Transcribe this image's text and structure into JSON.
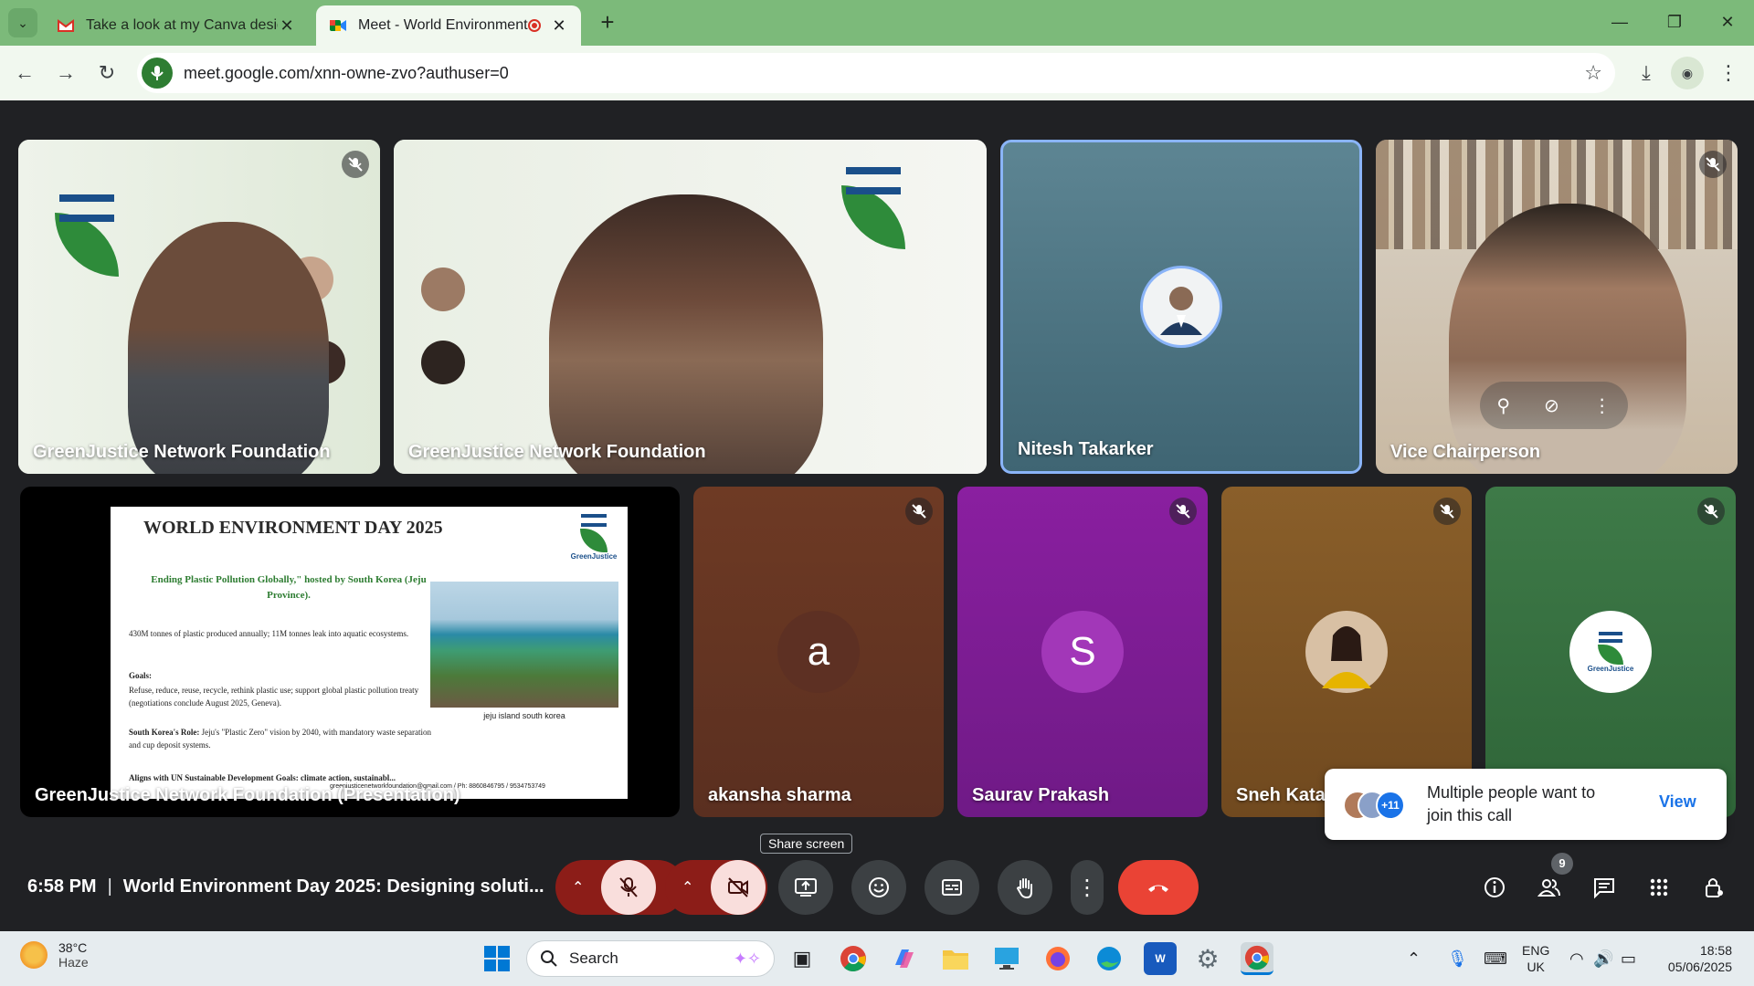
{
  "browser": {
    "tabs": [
      {
        "title": "Take a look at my Canva design",
        "icon": "gmail-icon"
      },
      {
        "title": "Meet - World Environment Day",
        "icon": "google-meet-icon",
        "recording": true
      }
    ],
    "url": "meet.google.com/xnn-owne-zvo?authuser=0"
  },
  "tiles": {
    "top": [
      {
        "name": "GreenJustice Network Foundation",
        "muted": true
      },
      {
        "name": "GreenJustice Network Foundation",
        "muted": false
      },
      {
        "name": "Nitesh Takarker",
        "muted": false,
        "active_speaker": true
      },
      {
        "name": "Vice Chairperson",
        "muted": true
      }
    ],
    "presentation": {
      "name": "GreenJustice Network Foundation (Presentation)"
    },
    "bottom": [
      {
        "name": "akansha sharma",
        "initial": "a",
        "color": "#5d3023",
        "muted": true
      },
      {
        "name": "Saurav Prakash",
        "initial": "S",
        "color": "#8e24aa",
        "muted": true
      },
      {
        "name": "Sneh Katar",
        "muted": true
      },
      {
        "name": "",
        "muted": true
      }
    ]
  },
  "slide": {
    "title": "WORLD ENVIRONMENT DAY 2025",
    "logo_text": "GreenJustice",
    "subtitle": "Ending Plastic Pollution Globally,\" hosted by South Korea (Jeju Province).",
    "fact": "430M tonnes of plastic produced annually; 11M tonnes leak into aquatic ecosystems.",
    "goals_heading": "Goals:",
    "goals_text": "Refuse, reduce, reuse, recycle, rethink plastic use; support global plastic pollution treaty (negotiations conclude August 2025, Geneva).",
    "korea_heading": "South Korea's Role:",
    "korea_text": "Jeju's \"Plastic Zero\" vision by 2040, with mandatory waste separation and cup deposit systems.",
    "aligns": "Aligns with UN Sustainable Development Goals: climate action, sustainabl...",
    "contact": "greenjusticenetworkfoundation@gmail.com / Ph: 8860846795 / 9534753749",
    "photo_caption": "jeju island south korea"
  },
  "toast": {
    "message": "Multiple people want to join this call",
    "action": "View",
    "extra_count": "+11"
  },
  "tooltip": "Share screen",
  "meeting": {
    "time": "6:58 PM",
    "separator": "|",
    "title": "World Environment Day 2025: Designing soluti...",
    "people_count": "9"
  },
  "taskbar": {
    "weather_temp": "38°C",
    "weather_desc": "Haze",
    "search_label": "Search",
    "lang_1": "ENG",
    "lang_2": "UK",
    "time": "18:58",
    "date": "05/06/2025"
  },
  "colors": {
    "meet_bg": "#202124",
    "end_call": "#ea4335",
    "active_border": "#8ab4f8",
    "chrome_frame": "#7cba7a"
  }
}
